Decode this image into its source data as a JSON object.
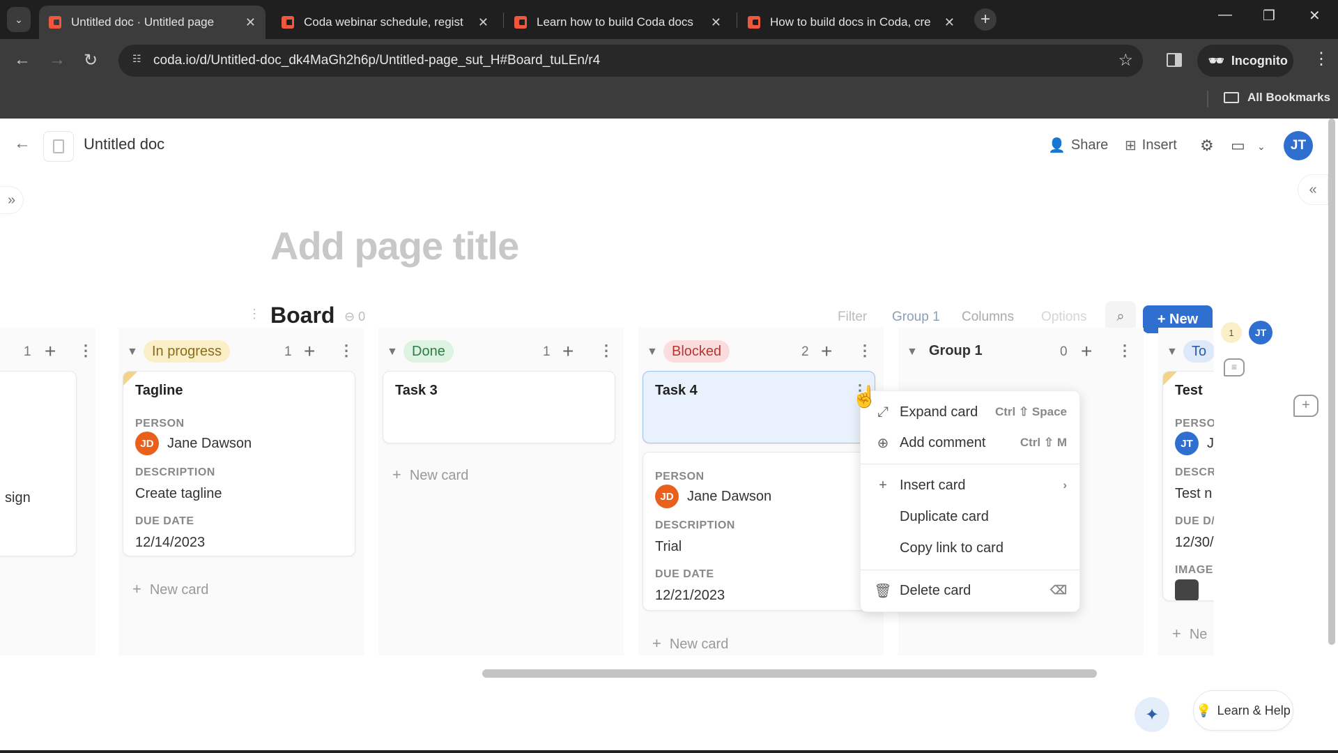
{
  "browser": {
    "tabs": [
      {
        "title": "Untitled doc · Untitled page",
        "active": true
      },
      {
        "title": "Coda webinar schedule, regist",
        "active": false
      },
      {
        "title": "Learn how to build Coda docs",
        "active": false
      },
      {
        "title": "How to build docs in Coda, cre",
        "active": false
      }
    ],
    "close_glyph": "✕",
    "new_tab_glyph": "+",
    "url": "coda.io/d/Untitled-doc_dk4MaGh2h6p/Untitled-page_sut_H#Board_tuLEn/r4",
    "incognito_label": "Incognito",
    "bookmarks_label": "All Bookmarks",
    "window_controls": {
      "minimize": "—",
      "restore": "❐",
      "close": "✕"
    }
  },
  "doc": {
    "title": "Untitled doc",
    "header_actions": {
      "share": "Share",
      "insert": "Insert"
    },
    "user_initials": "JT",
    "page_title_placeholder": "Add page title"
  },
  "board": {
    "title": "Board",
    "link_count": "0",
    "toolbar": {
      "filter": "Filter",
      "group": "Group",
      "group_count": "1",
      "columns": "Columns",
      "options": "Options"
    },
    "new_button": "+ New",
    "presence": {
      "badge_count": "1",
      "initials": "JT"
    },
    "new_card_label": "New card",
    "columns": [
      {
        "name": "",
        "count": "1",
        "cards": [
          {
            "title": "",
            "description_fragment": "sign"
          }
        ]
      },
      {
        "name": "In progress",
        "count": "1",
        "pill_bg": "#fbefc8",
        "pill_fg": "#8a6d1a",
        "cards": [
          {
            "title": "Tagline",
            "person_label": "PERSON",
            "person": "Jane Dawson",
            "person_initials": "JD",
            "description_label": "DESCRIPTION",
            "description": "Create tagline",
            "due_label": "DUE DATE",
            "due": "12/14/2023"
          }
        ]
      },
      {
        "name": "Done",
        "count": "1",
        "pill_bg": "#dcf3e1",
        "pill_fg": "#2e7d43",
        "cards": [
          {
            "title": "Task 3"
          }
        ]
      },
      {
        "name": "Blocked",
        "count": "2",
        "pill_bg": "#fbdcdc",
        "pill_fg": "#b83434",
        "cards": [
          {
            "title": "Task 4"
          },
          {
            "title": "",
            "person_label": "PERSON",
            "person": "Jane Dawson",
            "person_initials": "JD",
            "description_label": "DESCRIPTION",
            "description": "Trial",
            "due_label": "DUE DATE",
            "due": "12/21/2023"
          }
        ]
      },
      {
        "name": "Group 1",
        "count": "0",
        "cards": []
      },
      {
        "name": "To",
        "pill_bg": "#dde9f8",
        "pill_fg": "#2a5da8",
        "cards": [
          {
            "title": "Test",
            "person_label": "PERSO",
            "person": "J",
            "person_initials": "JT",
            "description_label": "DESCR",
            "description": "Test n",
            "due_label": "DUE D/",
            "due": "12/30/",
            "image_label": "IMAGE"
          }
        ],
        "new_card_label": "Ne"
      }
    ]
  },
  "context_menu": {
    "items": [
      {
        "label": "Expand card",
        "icon": "expand-icon",
        "shortcut": "Ctrl ⇧ Space"
      },
      {
        "label": "Add comment",
        "icon": "add-comment-icon",
        "shortcut": "Ctrl ⇧ M"
      },
      {
        "label": "Insert card",
        "icon": "plus-icon",
        "submenu": "›"
      },
      {
        "label": "Duplicate card"
      },
      {
        "label": "Copy link to card"
      },
      {
        "label": "Delete card",
        "icon": "trash-icon",
        "shortcut": "⌫"
      }
    ]
  },
  "footer": {
    "help_label": "Learn & Help"
  },
  "colors": {
    "accent": "#2f6fd0",
    "avatar_jd": "#e8601c",
    "avatar_jt": "#2f6fd0"
  }
}
